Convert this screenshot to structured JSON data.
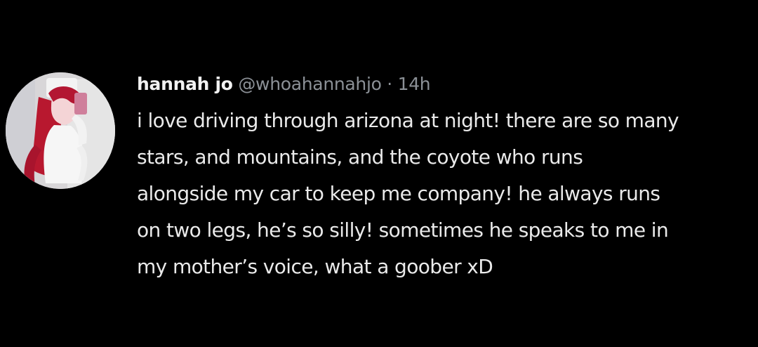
{
  "tweet": {
    "display_name": "hannah jo",
    "handle": "@whoahannahjo",
    "separator": "·",
    "timestamp": "14h",
    "text_lines": [
      "i love driving through arizona at night! there are so many",
      "stars, and mountains, and the coyote who runs",
      "alongside my car to keep me company! he always runs",
      "on two legs, he’s so silly! sometimes he speaks to me in",
      "my mother’s voice, what a goober xD"
    ]
  },
  "colors": {
    "background": "#000000",
    "text": "#eaeaea",
    "muted": "#8b9096",
    "avatar_background": "#d9d6d8",
    "avatar_hair": "#b8182f"
  }
}
